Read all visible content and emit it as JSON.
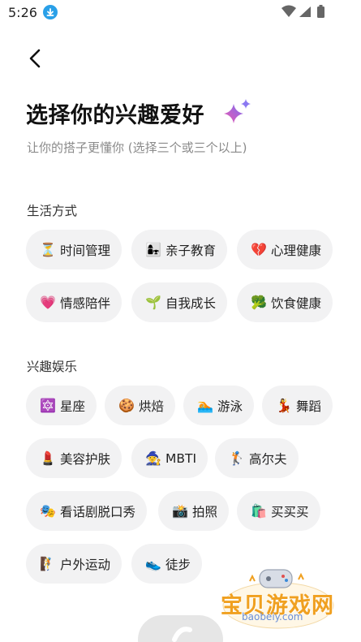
{
  "status_bar": {
    "time": "5:26"
  },
  "header": {
    "title": "选择你的兴趣爱好",
    "subtitle": "让你的搭子更懂你 (选择三个或三个以上)"
  },
  "sections": [
    {
      "title": "生活方式",
      "chips": [
        {
          "emoji": "⏳",
          "label": "时间管理"
        },
        {
          "emoji": "👩‍👧",
          "label": "亲子教育"
        },
        {
          "emoji": "💔",
          "label": "心理健康"
        },
        {
          "emoji": "💗",
          "label": "情感陪伴"
        },
        {
          "emoji": "🌱",
          "label": "自我成长"
        },
        {
          "emoji": "🥦",
          "label": "饮食健康"
        }
      ]
    },
    {
      "title": "兴趣娱乐",
      "chips": [
        {
          "emoji": "🔯",
          "label": "星座"
        },
        {
          "emoji": "🍪",
          "label": "烘焙"
        },
        {
          "emoji": "🏊",
          "label": "游泳"
        },
        {
          "emoji": "💃",
          "label": "舞蹈"
        },
        {
          "emoji": "💄",
          "label": "美容护肤"
        },
        {
          "emoji": "🧙",
          "label": "MBTI"
        },
        {
          "emoji": "🏌️",
          "label": "高尔夫"
        },
        {
          "emoji": "🎭",
          "label": "看话剧脱口秀"
        },
        {
          "emoji": "📸",
          "label": "拍照"
        },
        {
          "emoji": "🛍️",
          "label": "买买买"
        },
        {
          "emoji": "🧗",
          "label": "户外运动"
        },
        {
          "emoji": "👟",
          "label": "徒步"
        }
      ]
    }
  ],
  "watermark": {
    "text": "宝贝游戏网",
    "url": "baobeiy.com"
  },
  "colors": {
    "chip_bg": "#f2f2f3",
    "accent": "#2aa0e8",
    "subtitle": "#8a8a8a",
    "watermark": "#f0a020"
  }
}
